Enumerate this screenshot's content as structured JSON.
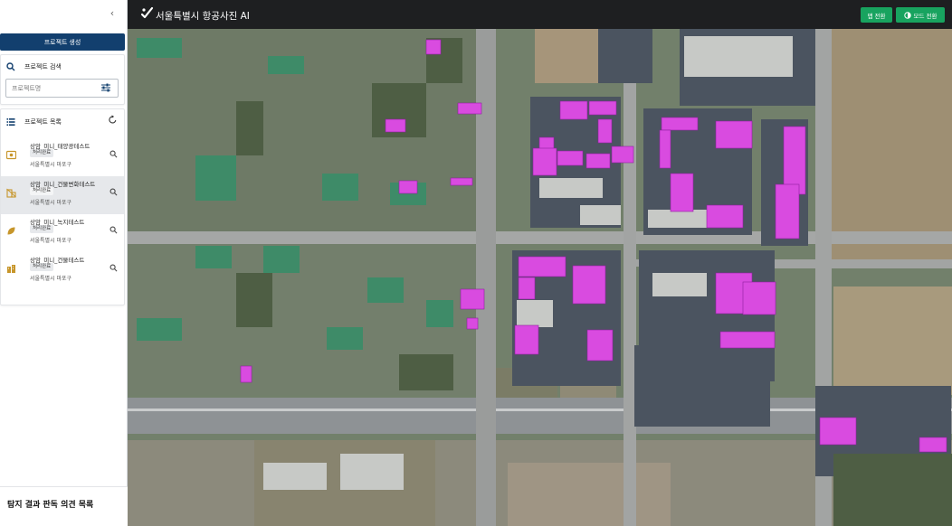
{
  "sidebar": {
    "create_button": "프로젝트 생성",
    "search": {
      "heading": "프로젝트 검색",
      "placeholder": "프로젝트명"
    },
    "list": {
      "heading": "프로젝트 목록",
      "items": [
        {
          "name": "상암_미니_태양광테스트",
          "status": "처리완료",
          "location": "서울특별시 마포구",
          "icon": "solar-panel-icon"
        },
        {
          "name": "상암_미니_건물변화테스트",
          "status": "처리완료",
          "location": "서울특별시 마포구",
          "icon": "building-change-icon"
        },
        {
          "name": "상암_미니_녹지테스트",
          "status": "처리완료",
          "location": "서울특별시 마포구",
          "icon": "leaf-icon"
        },
        {
          "name": "상암_미니_건물테스트",
          "status": "처리완료",
          "location": "서울특별시 마포구",
          "icon": "building-icon"
        }
      ]
    },
    "bottom_title": "탐지 결과 판독 의견 목록"
  },
  "header": {
    "title": "서울특별시 항공사진 AI",
    "map_toggle_button": "맵 전환",
    "mode_toggle_button": "모드 전환"
  },
  "colors": {
    "brand_navy": "#123f6e",
    "accent_green": "#18a35f",
    "topbar_bg": "#1e1f21",
    "detection_highlight": "#d94be0"
  }
}
